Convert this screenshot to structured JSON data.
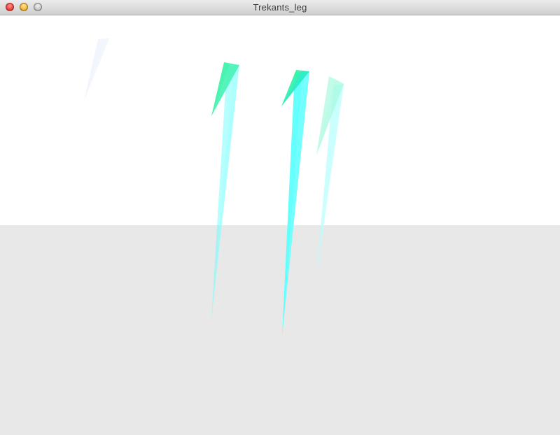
{
  "window": {
    "title": "Trekants_leg"
  },
  "scene": {
    "background_upper": "#ffffff",
    "floor_color": "#e8e8e8",
    "shard_color": "#5dfffd",
    "shard_head_color": "#37f2a9"
  }
}
